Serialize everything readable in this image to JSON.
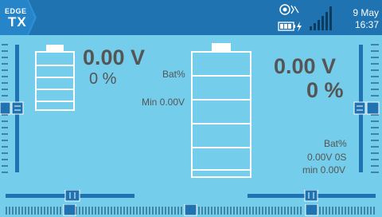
{
  "brand": {
    "line1": "EDGE",
    "line2": "TX"
  },
  "status": {
    "date": "9 May",
    "time": "16:37"
  },
  "icons": {
    "logo": "edgetx-logo",
    "audio": "audio-icon",
    "battery": "radio-battery-icon",
    "charging": "charging-bolt-icon",
    "signal": "signal-bars-icon"
  },
  "widget_left": {
    "voltage": "0.00 V",
    "percent": "0 %"
  },
  "widget_center": {
    "label_bat": "Bat%",
    "label_min": "Min 0.00V"
  },
  "widget_right": {
    "voltage": "0.00 V",
    "percent": "0 %",
    "label_bat": "Bat%",
    "label_sensor": "0.00V 0S",
    "label_min": "min 0.00V"
  },
  "battery_fill": {
    "left": 0,
    "center": 0
  },
  "colors": {
    "background": "#74cdea",
    "topbar": "#1e73b0",
    "trim": "#1e73b0",
    "text": "#555555",
    "outline": "#ffffff"
  }
}
